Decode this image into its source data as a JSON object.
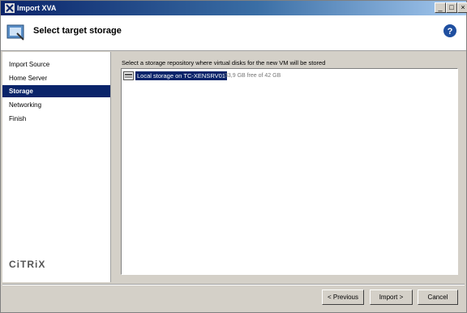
{
  "window": {
    "title": "Import XVA"
  },
  "header": {
    "title": "Select target storage"
  },
  "sidebar": {
    "items": [
      {
        "label": "Import Source"
      },
      {
        "label": "Home Server"
      },
      {
        "label": "Storage"
      },
      {
        "label": "Networking"
      },
      {
        "label": "Finish"
      }
    ],
    "active": "Storage",
    "logo": "CiTRiX"
  },
  "main": {
    "instruction": "Select a storage repository where virtual disks for the new VM will be stored",
    "storage_list": [
      {
        "name": "Local storage on TC-XENSRV01",
        "free": "33,9 GB free of 42 GB",
        "selected": true
      }
    ]
  },
  "buttons": {
    "previous": "< Previous",
    "import": "Import >",
    "cancel": "Cancel"
  },
  "colors": {
    "selection": "#0a246a",
    "window_bg": "#d4d0c8"
  }
}
